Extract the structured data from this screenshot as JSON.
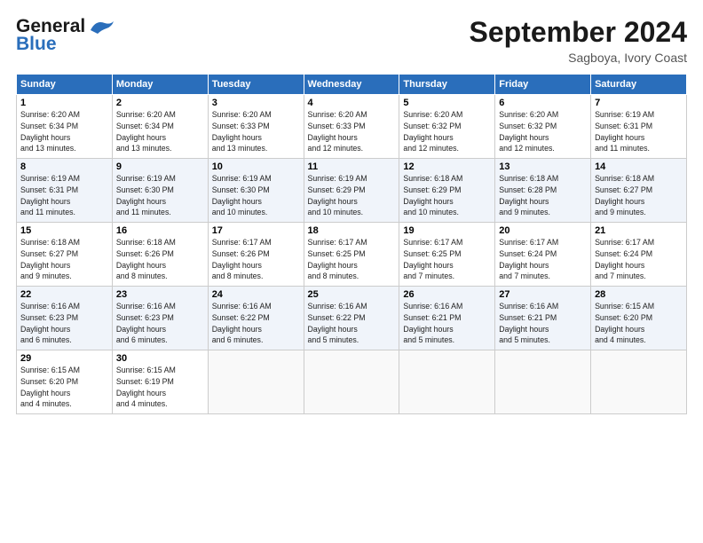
{
  "header": {
    "logo_line1": "General",
    "logo_line2": "Blue",
    "month_title": "September 2024",
    "location": "Sagboya, Ivory Coast"
  },
  "weekdays": [
    "Sunday",
    "Monday",
    "Tuesday",
    "Wednesday",
    "Thursday",
    "Friday",
    "Saturday"
  ],
  "weeks": [
    [
      {
        "day": "1",
        "sunrise": "6:20 AM",
        "sunset": "6:34 PM",
        "daylight": "12 hours and 13 minutes."
      },
      {
        "day": "2",
        "sunrise": "6:20 AM",
        "sunset": "6:34 PM",
        "daylight": "12 hours and 13 minutes."
      },
      {
        "day": "3",
        "sunrise": "6:20 AM",
        "sunset": "6:33 PM",
        "daylight": "12 hours and 13 minutes."
      },
      {
        "day": "4",
        "sunrise": "6:20 AM",
        "sunset": "6:33 PM",
        "daylight": "12 hours and 12 minutes."
      },
      {
        "day": "5",
        "sunrise": "6:20 AM",
        "sunset": "6:32 PM",
        "daylight": "12 hours and 12 minutes."
      },
      {
        "day": "6",
        "sunrise": "6:20 AM",
        "sunset": "6:32 PM",
        "daylight": "12 hours and 12 minutes."
      },
      {
        "day": "7",
        "sunrise": "6:19 AM",
        "sunset": "6:31 PM",
        "daylight": "12 hours and 11 minutes."
      }
    ],
    [
      {
        "day": "8",
        "sunrise": "6:19 AM",
        "sunset": "6:31 PM",
        "daylight": "12 hours and 11 minutes."
      },
      {
        "day": "9",
        "sunrise": "6:19 AM",
        "sunset": "6:30 PM",
        "daylight": "12 hours and 11 minutes."
      },
      {
        "day": "10",
        "sunrise": "6:19 AM",
        "sunset": "6:30 PM",
        "daylight": "12 hours and 10 minutes."
      },
      {
        "day": "11",
        "sunrise": "6:19 AM",
        "sunset": "6:29 PM",
        "daylight": "12 hours and 10 minutes."
      },
      {
        "day": "12",
        "sunrise": "6:18 AM",
        "sunset": "6:29 PM",
        "daylight": "12 hours and 10 minutes."
      },
      {
        "day": "13",
        "sunrise": "6:18 AM",
        "sunset": "6:28 PM",
        "daylight": "12 hours and 9 minutes."
      },
      {
        "day": "14",
        "sunrise": "6:18 AM",
        "sunset": "6:27 PM",
        "daylight": "12 hours and 9 minutes."
      }
    ],
    [
      {
        "day": "15",
        "sunrise": "6:18 AM",
        "sunset": "6:27 PM",
        "daylight": "12 hours and 9 minutes."
      },
      {
        "day": "16",
        "sunrise": "6:18 AM",
        "sunset": "6:26 PM",
        "daylight": "12 hours and 8 minutes."
      },
      {
        "day": "17",
        "sunrise": "6:17 AM",
        "sunset": "6:26 PM",
        "daylight": "12 hours and 8 minutes."
      },
      {
        "day": "18",
        "sunrise": "6:17 AM",
        "sunset": "6:25 PM",
        "daylight": "12 hours and 8 minutes."
      },
      {
        "day": "19",
        "sunrise": "6:17 AM",
        "sunset": "6:25 PM",
        "daylight": "12 hours and 7 minutes."
      },
      {
        "day": "20",
        "sunrise": "6:17 AM",
        "sunset": "6:24 PM",
        "daylight": "12 hours and 7 minutes."
      },
      {
        "day": "21",
        "sunrise": "6:17 AM",
        "sunset": "6:24 PM",
        "daylight": "12 hours and 7 minutes."
      }
    ],
    [
      {
        "day": "22",
        "sunrise": "6:16 AM",
        "sunset": "6:23 PM",
        "daylight": "12 hours and 6 minutes."
      },
      {
        "day": "23",
        "sunrise": "6:16 AM",
        "sunset": "6:23 PM",
        "daylight": "12 hours and 6 minutes."
      },
      {
        "day": "24",
        "sunrise": "6:16 AM",
        "sunset": "6:22 PM",
        "daylight": "12 hours and 6 minutes."
      },
      {
        "day": "25",
        "sunrise": "6:16 AM",
        "sunset": "6:22 PM",
        "daylight": "12 hours and 5 minutes."
      },
      {
        "day": "26",
        "sunrise": "6:16 AM",
        "sunset": "6:21 PM",
        "daylight": "12 hours and 5 minutes."
      },
      {
        "day": "27",
        "sunrise": "6:16 AM",
        "sunset": "6:21 PM",
        "daylight": "12 hours and 5 minutes."
      },
      {
        "day": "28",
        "sunrise": "6:15 AM",
        "sunset": "6:20 PM",
        "daylight": "12 hours and 4 minutes."
      }
    ],
    [
      {
        "day": "29",
        "sunrise": "6:15 AM",
        "sunset": "6:20 PM",
        "daylight": "12 hours and 4 minutes."
      },
      {
        "day": "30",
        "sunrise": "6:15 AM",
        "sunset": "6:19 PM",
        "daylight": "12 hours and 4 minutes."
      },
      {
        "day": "",
        "sunrise": "",
        "sunset": "",
        "daylight": ""
      },
      {
        "day": "",
        "sunrise": "",
        "sunset": "",
        "daylight": ""
      },
      {
        "day": "",
        "sunrise": "",
        "sunset": "",
        "daylight": ""
      },
      {
        "day": "",
        "sunrise": "",
        "sunset": "",
        "daylight": ""
      },
      {
        "day": "",
        "sunrise": "",
        "sunset": "",
        "daylight": ""
      }
    ]
  ]
}
